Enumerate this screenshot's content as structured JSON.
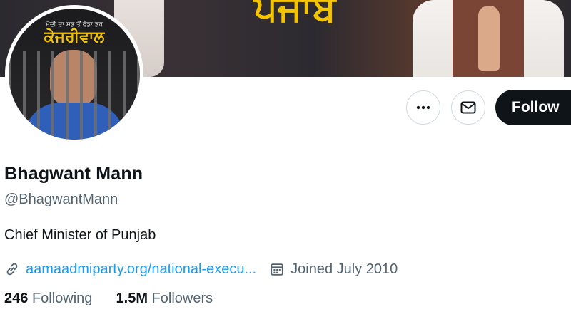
{
  "banner": {
    "title": "ਪੰਜਾਬ"
  },
  "avatar": {
    "caption_small": "ਮੋਦੀ ਦਾ ਸਭ ਤੋਂ ਵੱਡਾ ਡਰ",
    "caption_big": "ਕੇਜਰੀਵਾਲ"
  },
  "actions": {
    "more_icon": "more-horizontal-icon",
    "message_icon": "envelope-icon",
    "follow_label": "Follow"
  },
  "profile": {
    "name": "Bhagwant Mann",
    "handle": "@BhagwantMann",
    "bio": "Chief Minister of Punjab",
    "website": "aamaadmiparty.org/national-execu...",
    "joined": "Joined July 2010",
    "following_count": "246",
    "following_label": "Following",
    "followers_count": "1.5M",
    "followers_label": "Followers"
  },
  "colors": {
    "accent": "#1d9bf0",
    "text_primary": "#0f1419",
    "text_secondary": "#536471",
    "follow_bg": "#0f1419",
    "banner_title": "#f5c400"
  }
}
